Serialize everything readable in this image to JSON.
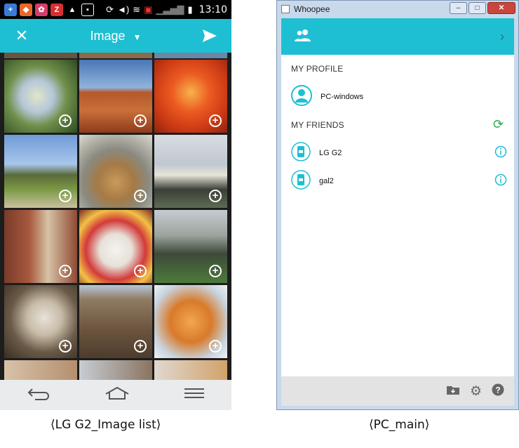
{
  "phone": {
    "status_time": "13:10",
    "appbar": {
      "title": "Image"
    },
    "caption": "⟨LG G2_Image list⟩"
  },
  "pc": {
    "window_title": "Whoopee",
    "my_profile_label": "MY PROFILE",
    "profile_name": "PC-windows",
    "my_friends_label": "MY FRIENDS",
    "friends": [
      {
        "name": "LG G2"
      },
      {
        "name": "gal2"
      }
    ],
    "caption": "⟨PC_main⟩",
    "colors": {
      "accent": "#1ebfd2",
      "refresh": "#2faa55"
    }
  }
}
